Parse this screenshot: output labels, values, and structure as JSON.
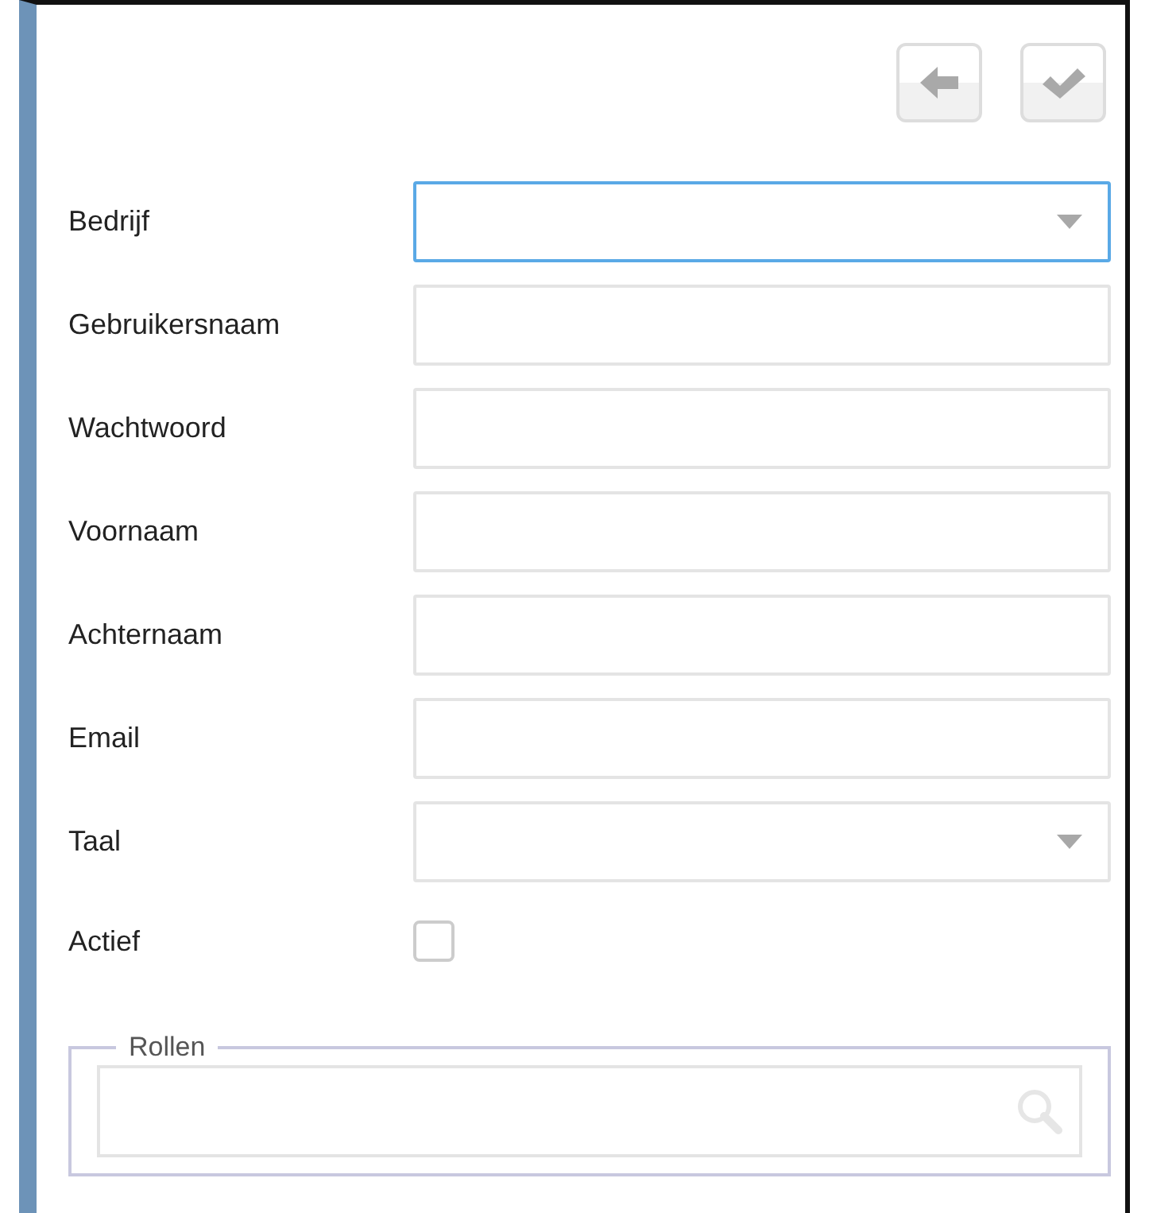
{
  "toolbar": {
    "buttons": [
      {
        "kind": "back",
        "disabled": true
      },
      {
        "kind": "confirm",
        "disabled": true
      }
    ]
  },
  "fields": [
    {
      "label": "Bedrijf",
      "kind": "select",
      "focused": true
    },
    {
      "label": "Gebruikersnaam",
      "kind": "text",
      "focused": false
    },
    {
      "label": "Wachtwoord",
      "kind": "password",
      "focused": false
    },
    {
      "label": "Voornaam",
      "kind": "text",
      "focused": false
    },
    {
      "label": "Achternaam",
      "kind": "text",
      "focused": false
    },
    {
      "label": "Email",
      "kind": "text",
      "focused": false
    },
    {
      "label": "Taal",
      "kind": "select",
      "focused": false
    },
    {
      "label": "Actief",
      "kind": "checkbox",
      "checked": false
    }
  ],
  "roles": {
    "legend": "Rollen"
  }
}
